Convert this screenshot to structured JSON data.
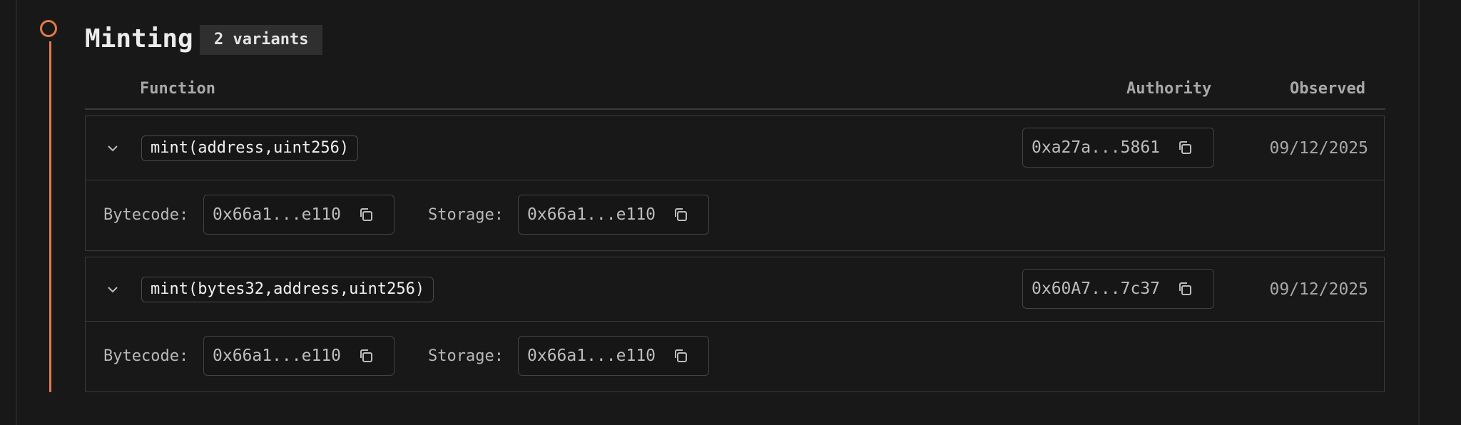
{
  "section": {
    "title": "Minting",
    "badge": "2 variants"
  },
  "columns": {
    "function": "Function",
    "authority": "Authority",
    "observed": "Observed"
  },
  "labels": {
    "bytecode": "Bytecode:",
    "storage": "Storage:"
  },
  "accent_color": "#e47a45",
  "rows": [
    {
      "signature": "mint(address,uint256)",
      "authority": "0xa27a...5861",
      "observed": "09/12/2025",
      "bytecode": "0x66a1...e110",
      "storage": "0x66a1...e110",
      "expanded": true
    },
    {
      "signature": "mint(bytes32,address,uint256)",
      "authority": "0x60A7...7c37",
      "observed": "09/12/2025",
      "bytecode": "0x66a1...e110",
      "storage": "0x66a1...e110",
      "expanded": true
    }
  ]
}
